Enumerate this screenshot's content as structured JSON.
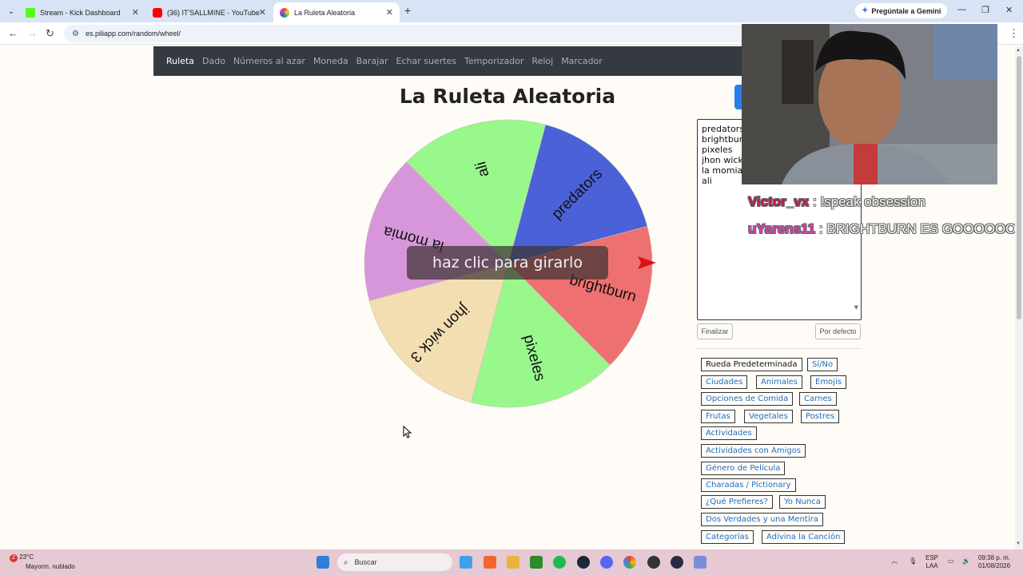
{
  "browser": {
    "tabs": [
      {
        "label": "Stream - Kick Dashboard",
        "color": "#53fc18"
      },
      {
        "label": "(36) IT'SALLMINE - YouTube",
        "color": "#ff0000"
      },
      {
        "label": "La Ruleta Aleatoria",
        "color": "#9b59b6"
      }
    ],
    "gemini": "Pregúntale a Gemini",
    "url": "es.piliapp.com/random/wheel/"
  },
  "nav": [
    "Ruleta",
    "Dado",
    "Números al azar",
    "Moneda",
    "Barajar",
    "Echar suertes",
    "Temporizador",
    "Reloj",
    "Marcador"
  ],
  "page": {
    "title": "La Ruleta Aleatoria",
    "spin_label": "haz clic para girarlo"
  },
  "wheel": {
    "segments": [
      {
        "label": "predators",
        "color": "#4a61d8"
      },
      {
        "label": "brightburn",
        "color": "#ef7070"
      },
      {
        "label": "pixeles",
        "color": "#98f88c"
      },
      {
        "label": "jhon wick 3",
        "color": "#f3deb2"
      },
      {
        "label": "la momia",
        "color": "#d796d9"
      },
      {
        "label": "ali",
        "color": "#98f88c"
      }
    ],
    "pointer_color": "#e01010"
  },
  "entries": {
    "lines": [
      "predators",
      "brightburn",
      "pixeles",
      "jhon wick 3",
      "la momia",
      "ali"
    ],
    "finish_label": "Finalizar",
    "default_label": "Por defecto"
  },
  "presets": [
    "Rueda Predeterminada",
    "Sí/No",
    "Ciudades",
    "Animales",
    "Emojis",
    "Opciones de Comida",
    "Carnes",
    "Frutas",
    "Vegetales",
    "Postres",
    "Actividades",
    "Actividades con Amigos",
    "Género de Película",
    "Charadas / Pictionary",
    "¿Qué Prefieres?",
    "Yo Nunca",
    "Dos Verdades y una Mentira",
    "Categorías",
    "Adivina la Canción"
  ],
  "chat": [
    {
      "user": "Victor_vx",
      "message": ": !speak obsession",
      "color": "#c2185b"
    },
    {
      "user": "uYarens11",
      "message": ": BRIGHTBURN ES GOOOOOOO",
      "color": "#d63fb0"
    }
  ],
  "taskbar": {
    "weather_temp": "23°C",
    "weather_desc": "Mayorm. nublado",
    "weather_badge": "2",
    "search_placeholder": "Buscar",
    "lang1": "ESP",
    "lang2": "LAA",
    "time": "09:38 p. m.",
    "date": "01/08/2026"
  }
}
